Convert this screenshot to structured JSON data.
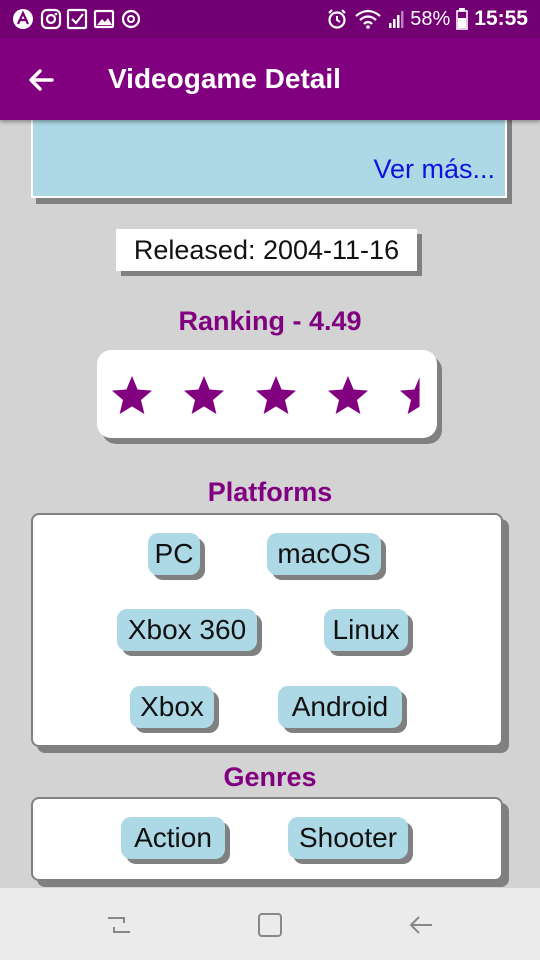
{
  "status_bar": {
    "battery": "58%",
    "time": "15:55",
    "icons": [
      "app-a-icon",
      "instagram-icon",
      "checklist-icon",
      "gallery-icon",
      "sync-icon",
      "alarm-icon",
      "wifi-icon",
      "signal-icon",
      "battery-icon"
    ]
  },
  "app_bar": {
    "title": "Videogame Detail",
    "back_icon": "arrow-back-icon"
  },
  "description": {
    "text": "",
    "ver_mas": "Ver más..."
  },
  "released": {
    "text": "Released: 2004-11-16"
  },
  "ranking": {
    "title": "Ranking - 4.49",
    "value": 4.49,
    "max": 5,
    "star_color": "#800080"
  },
  "platforms": {
    "title": "Platforms",
    "items": [
      "PC",
      "macOS",
      "Xbox 360",
      "Linux",
      "Xbox",
      "Android"
    ]
  },
  "genres": {
    "title": "Genres",
    "items": [
      "Action",
      "Shooter"
    ]
  },
  "nav_bar": {
    "icons": [
      "recent-apps-icon",
      "home-icon",
      "back-icon"
    ]
  },
  "colors": {
    "primary": "#800080",
    "status_bar": "#720072",
    "chip": "#add8e6",
    "background": "#d3d3d3",
    "link": "#1212e0"
  }
}
